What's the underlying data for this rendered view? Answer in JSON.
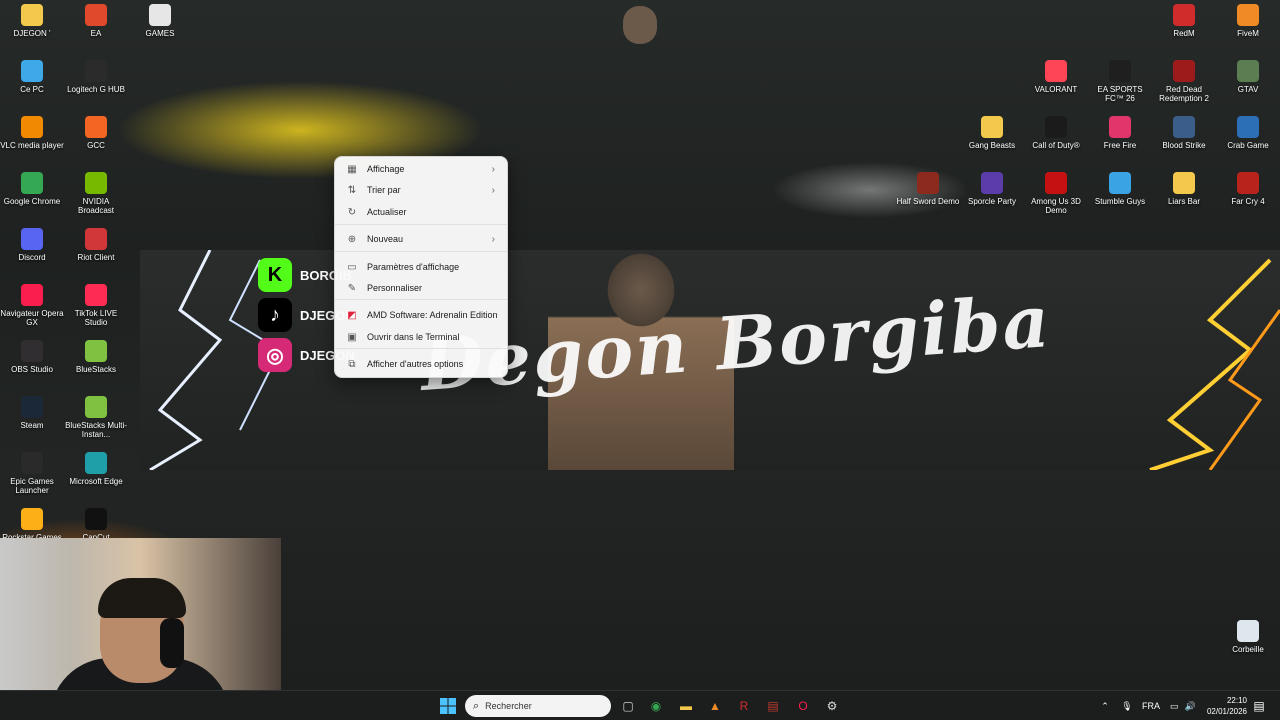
{
  "banner": {
    "script_text": "Degon Borgiba",
    "social": [
      {
        "label": "BORGIB",
        "icon": "kick-icon",
        "glyph": "K",
        "color": "#53fc18"
      },
      {
        "label": "DJEGON",
        "icon": "tiktok-icon",
        "glyph": "♪",
        "color": "#000000"
      },
      {
        "label": "DJEGON",
        "icon": "instagram-icon",
        "glyph": "◎",
        "color": "#d62976"
      }
    ]
  },
  "desktop_left": [
    {
      "label": "DJEGON '",
      "icon": "folder-icon",
      "color": "#f2c94c"
    },
    {
      "label": "EA",
      "icon": "ea-icon",
      "color": "#e0492b"
    },
    {
      "label": "GAMES",
      "icon": "file-icon",
      "color": "#e6e6e6"
    },
    {
      "label": "Ce PC",
      "icon": "computer-icon",
      "color": "#3fa9e8"
    },
    {
      "label": "Logitech G HUB",
      "icon": "logitech-icon",
      "color": "#2b2b2b"
    },
    {
      "label": "VLC media player",
      "icon": "vlc-icon",
      "color": "#f18a00"
    },
    {
      "label": "GCC",
      "icon": "gcc-icon",
      "color": "#f26522"
    },
    {
      "label": "Google Chrome",
      "icon": "chrome-icon",
      "color": "#34a853"
    },
    {
      "label": "NVIDIA Broadcast",
      "icon": "nvidia-icon",
      "color": "#76b900"
    },
    {
      "label": "Discord",
      "icon": "discord-icon",
      "color": "#5865f2"
    },
    {
      "label": "Riot Client",
      "icon": "riot-icon",
      "color": "#d13639"
    },
    {
      "label": "Navigateur Opera GX",
      "icon": "opera-gx-icon",
      "color": "#fa1e4e"
    },
    {
      "label": "TikTok LIVE Studio",
      "icon": "tiktok-live-icon",
      "color": "#fe2c55"
    },
    {
      "label": "OBS Studio",
      "icon": "obs-icon",
      "color": "#302e31"
    },
    {
      "label": "BlueStacks",
      "icon": "bluestacks-icon",
      "color": "#7fc241"
    },
    {
      "label": "Steam",
      "icon": "steam-icon",
      "color": "#1b2838"
    },
    {
      "label": "BlueStacks Multi-Instan...",
      "icon": "bluestacks-multi-icon",
      "color": "#7fc241"
    },
    {
      "label": "Epic Games Launcher",
      "icon": "epic-games-icon",
      "color": "#2a2a2a"
    },
    {
      "label": "Microsoft Edge",
      "icon": "edge-icon",
      "color": "#1fa0a8"
    },
    {
      "label": "Rockstar Games",
      "icon": "rockstar-icon",
      "color": "#fcaf17"
    },
    {
      "label": "CapCut",
      "icon": "capcut-icon",
      "color": "#111111"
    }
  ],
  "desktop_right": [
    {
      "label": "RedM",
      "icon": "redm-icon",
      "color": "#d12c2c"
    },
    {
      "label": "FiveM",
      "icon": "fivem-icon",
      "color": "#f08a24"
    },
    {
      "label": "VALORANT",
      "icon": "valorant-icon",
      "color": "#fd4556"
    },
    {
      "label": "EA SPORTS FC™ 26",
      "icon": "ea-fc-icon",
      "color": "#1f1f1f"
    },
    {
      "label": "Red Dead Redemption 2",
      "icon": "rdr2-icon",
      "color": "#9e1b1b"
    },
    {
      "label": "GTAV",
      "icon": "gtav-icon",
      "color": "#5a7d52"
    },
    {
      "label": "Gang Beasts",
      "icon": "gang-beasts-icon",
      "color": "#f2c94c"
    },
    {
      "label": "Call of Duty®",
      "icon": "cod-icon",
      "color": "#1b1b1b"
    },
    {
      "label": "Free Fire",
      "icon": "free-fire-icon",
      "color": "#e2356c"
    },
    {
      "label": "Blood Strike",
      "icon": "blood-strike-icon",
      "color": "#3b5d8a"
    },
    {
      "label": "Crab Game",
      "icon": "crab-game-icon",
      "color": "#2d6fb7"
    },
    {
      "label": "Half Sword Demo",
      "icon": "half-sword-icon",
      "color": "#8c2a1e"
    },
    {
      "label": "Sporcle Party",
      "icon": "sporcle-icon",
      "color": "#5b3ca8"
    },
    {
      "label": "Among Us 3D Demo",
      "icon": "among-us-icon",
      "color": "#c51111"
    },
    {
      "label": "Stumble Guys",
      "icon": "stumble-guys-icon",
      "color": "#3aa3e3"
    },
    {
      "label": "Liars Bar",
      "icon": "folder-icon",
      "color": "#f2c94c"
    },
    {
      "label": "Far Cry 4",
      "icon": "far-cry-icon",
      "color": "#b8231c"
    },
    {
      "label": "Corbeille",
      "icon": "recycle-bin-icon",
      "color": "#dfe7ee"
    }
  ],
  "context_menu": {
    "items": [
      {
        "label": "Affichage",
        "icon": "grid-icon",
        "glyph": "▦",
        "submenu": true
      },
      {
        "label": "Trier par",
        "icon": "sort-icon",
        "glyph": "⇅",
        "submenu": true
      },
      {
        "label": "Actualiser",
        "icon": "refresh-icon",
        "glyph": "↻",
        "submenu": false
      },
      {
        "label": "Nouveau",
        "icon": "plus-circle-icon",
        "glyph": "⊕",
        "submenu": true
      },
      {
        "label": "Paramètres d'affichage",
        "icon": "display-icon",
        "glyph": "▭",
        "submenu": false
      },
      {
        "label": "Personnaliser",
        "icon": "brush-icon",
        "glyph": "✎",
        "submenu": false
      },
      {
        "label": "AMD Software: Adrenalin Edition",
        "icon": "amd-icon",
        "glyph": "◩",
        "submenu": false
      },
      {
        "label": "Ouvrir dans le Terminal",
        "icon": "terminal-icon",
        "glyph": "▣",
        "submenu": false
      },
      {
        "label": "Afficher d'autres options",
        "icon": "more-options-icon",
        "glyph": "⧉",
        "submenu": false
      }
    ]
  },
  "taskbar": {
    "search_placeholder": "Rechercher",
    "language": "FRA",
    "time": "22:10",
    "date": "02/01/2026",
    "pinned": [
      {
        "name": "task-view-icon",
        "glyph": "▢",
        "color": "#cfcfcf"
      },
      {
        "name": "chrome-icon",
        "glyph": "◉",
        "color": "#34a853"
      },
      {
        "name": "file-explorer-icon",
        "glyph": "▬",
        "color": "#f2c94c"
      },
      {
        "name": "fivem-icon",
        "glyph": "▲",
        "color": "#f08a24"
      },
      {
        "name": "redm-icon",
        "glyph": "R",
        "color": "#d12c2c"
      },
      {
        "name": "mixer-icon",
        "glyph": "▤",
        "color": "#c0392b"
      },
      {
        "name": "opera-gx-icon",
        "glyph": "O",
        "color": "#fa1e4e"
      },
      {
        "name": "gear-icon",
        "glyph": "⚙",
        "color": "#dddddd"
      }
    ]
  }
}
